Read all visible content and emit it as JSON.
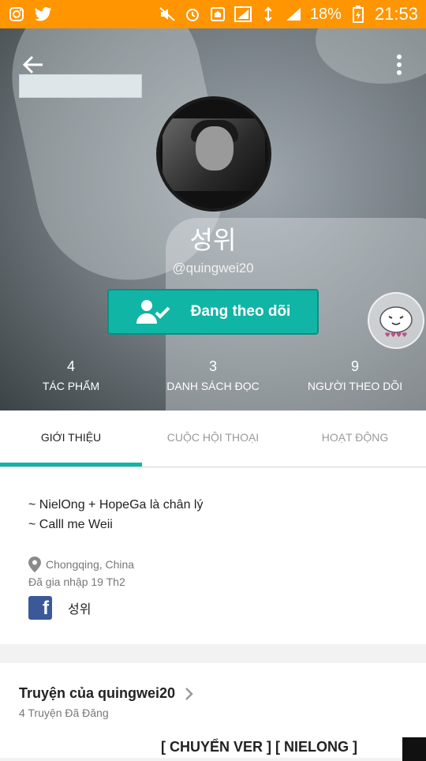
{
  "status_bar": {
    "left_icons": [
      "instagram-icon",
      "twitter-icon"
    ],
    "right_icons": [
      "mute-icon",
      "alarm-icon",
      "home-icon",
      "signal-alt-icon",
      "data-icon",
      "signal-icon"
    ],
    "battery": "18%",
    "time": "21:53"
  },
  "profile": {
    "display_name": "성위",
    "handle": "@quingwei20",
    "follow_button_label": "Đang theo dõi",
    "stats": [
      {
        "value": "4",
        "label": "TÁC PHẨM"
      },
      {
        "value": "3",
        "label": "DANH SÁCH ĐỌC"
      },
      {
        "value": "9",
        "label": "NGƯỜI THEO DÕI"
      }
    ]
  },
  "tabs": [
    {
      "label": "GIỚI THIỆU",
      "active": true
    },
    {
      "label": "CUỘC HỘI THOẠI",
      "active": false
    },
    {
      "label": "HOẠT ĐỘNG",
      "active": false
    }
  ],
  "about": {
    "bio_lines": [
      "~ NielOng + HopeGa là chân lý",
      "~ Calll me Weii"
    ],
    "location": "Chongqing, China",
    "joined": "Đã gia nhập 19 Th2",
    "facebook_name": "성위"
  },
  "stories": {
    "title": "Truyện của quingwei20",
    "count_label": "4 Truyện Đã Đăng",
    "first_story_title": "[ CHUYỂN VER ] [ NIELONG ]"
  },
  "colors": {
    "status_bar": "#ff9500",
    "accent": "#11b5a6",
    "facebook": "#3b5998"
  }
}
